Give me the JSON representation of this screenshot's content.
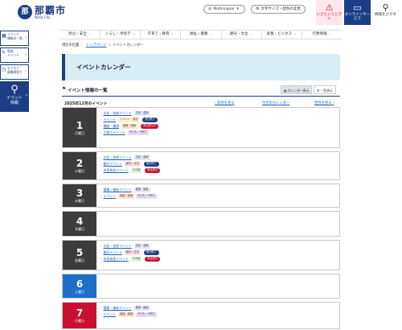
{
  "header": {
    "logo_mark": "那",
    "logo_name": "那覇市",
    "logo_en": "Naha City",
    "multilingual": "Multilingual",
    "text_size": "文字サイズ・配色の変更",
    "emergency": "いざというときに",
    "online": "オンラインサービス",
    "find": "情報をさがす"
  },
  "nav": [
    "防災・安全",
    "くらし・手続き",
    "子育て・教育",
    "福祉・健康",
    "観光・文化",
    "産業・ビジネス",
    "行政情報"
  ],
  "side": {
    "items": [
      {
        "label_1": "イベント",
        "label_2": "情報の一覧"
      },
      {
        "label_1": "登録",
        "label_2": "イベント"
      },
      {
        "label_1": "もうすぐ",
        "label_2": "募集締切り"
      }
    ],
    "event_label_1": "イベント",
    "event_label_2": "情報"
  },
  "breadcrumb": {
    "items": [
      "現在の位置",
      "トップページ",
      "イベントカレンダー"
    ]
  },
  "page_title": "イベントカレンダー",
  "list": {
    "title": "イベント情報の一覧",
    "calendar_view": "カレンダー表示",
    "list_view": "一覧表示",
    "month_label": "2025年12月のイベント",
    "prev_month": "前月を見る",
    "this_month": "今月のカレンダー",
    "next_month": "翌月を見る"
  },
  "days": [
    {
      "num": "1",
      "wd": "月曜日",
      "events": [
        {
          "t": "文化・芸術イベント",
          "tags": [
            "文化・芸術"
          ],
          "status": ""
        },
        {
          "t": "イベント",
          "tags": [
            "イベント・講座"
          ],
          "status": "受付終了"
        },
        {
          "t": "講座・講演",
          "tags": [
            "講座・講演"
          ],
          "status": "申込受付中"
        },
        {
          "t": "子育てイベント",
          "tags": [
            "子ども・子育て"
          ],
          "status": ""
        }
      ]
    },
    {
      "num": "2",
      "wd": "火曜日",
      "events": [
        {
          "t": "文化・芸術イベント",
          "tags": [
            "文化・芸術"
          ],
          "status": ""
        },
        {
          "t": "観光イベント",
          "tags": [
            "観光・交流"
          ],
          "status": "受付終了"
        },
        {
          "t": "市民参加イベント",
          "tags": [
            "その他"
          ],
          "status": "申込受付"
        }
      ]
    },
    {
      "num": "3",
      "wd": "水曜日",
      "events": [
        {
          "t": "健康・福祉イベント",
          "tags": [
            "健康・福祉"
          ],
          "status": ""
        },
        {
          "t": "イベント",
          "tags": [
            "講座・講演",
            "子ども・子育て"
          ],
          "status": ""
        }
      ]
    },
    {
      "num": "4",
      "wd": "木曜日",
      "events": []
    },
    {
      "num": "5",
      "wd": "金曜日",
      "events": [
        {
          "t": "文化・芸術イベント",
          "tags": [
            "文化・芸術"
          ],
          "status": ""
        },
        {
          "t": "観光イベント",
          "tags": [
            "観光・交流"
          ],
          "status": "受付終了"
        },
        {
          "t": "市民参加イベント",
          "tags": [
            "その他"
          ],
          "status": "申込受付"
        }
      ]
    },
    {
      "num": "6",
      "wd": "土曜日",
      "events": []
    },
    {
      "num": "7",
      "wd": "日曜日",
      "events": [
        {
          "t": "健康・福祉イベント",
          "tags": [
            "健康・福祉"
          ],
          "status": ""
        },
        {
          "t": "イベント",
          "tags": [
            "講座・講演",
            "子ども・子育て"
          ],
          "status": ""
        }
      ]
    }
  ],
  "colors": {
    "brand": "#1b3e86",
    "saturday": "#1d6fc9",
    "sunday": "#c8102e",
    "tags": {
      "文化・芸術": [
        "#e3e8f7",
        "#334"
      ],
      "イベント・講座": [
        "#fff2c9",
        "#553"
      ],
      "講座・講演": [
        "#ffe1cc",
        "#533"
      ],
      "子ども・子育て": [
        "#e6dcf5",
        "#435"
      ],
      "観光・交流": [
        "#fde0e6",
        "#533"
      ],
      "健康・福祉": [
        "#e3e8f7",
        "#334"
      ],
      "その他": [
        "#e3f3dc",
        "#353"
      ]
    },
    "status": {
      "受付終了": "#1b3e86",
      "申込受付中": "#c8102e",
      "申込受付": "#c8102e"
    }
  }
}
